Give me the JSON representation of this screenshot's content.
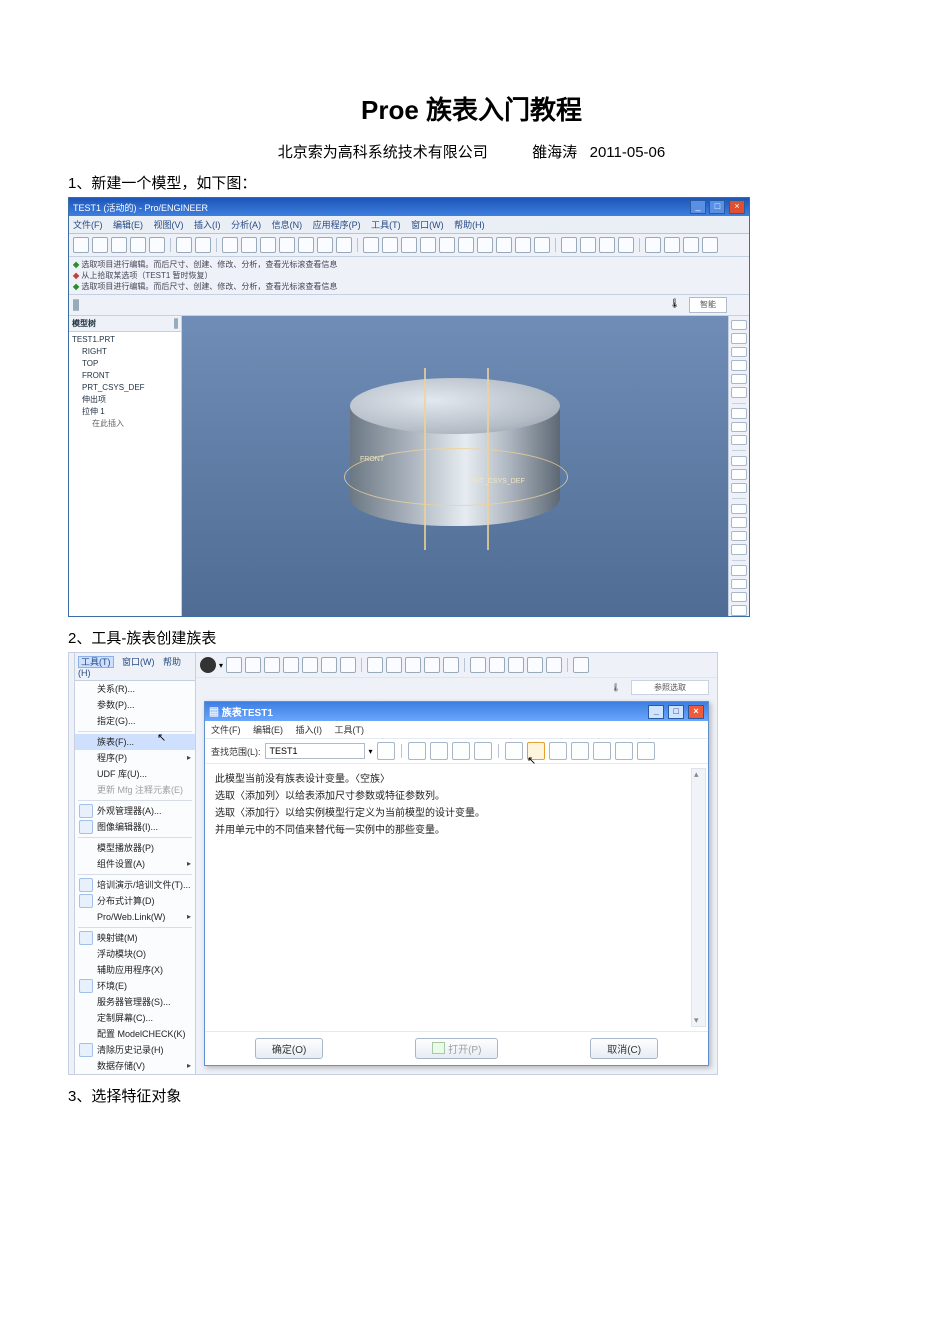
{
  "doc": {
    "title": "Proe 族表入门教程",
    "company": "北京索为高科系统技术有限公司",
    "author": "雒海涛",
    "date": "2011-05-06",
    "step1": "1、新建一个模型，如下图：",
    "step2": "2、工具-族表创建族表",
    "step3": "3、选择特征对象"
  },
  "shot1": {
    "title": "TEST1 (活动的) - Pro/ENGINEER",
    "menus": [
      "文件(F)",
      "编辑(E)",
      "视图(V)",
      "插入(I)",
      "分析(A)",
      "信息(N)",
      "应用程序(P)",
      "工具(T)",
      "窗口(W)",
      "帮助(H)"
    ],
    "msg1": "选取项目进行编辑。而后尺寸、创建、修改、分析，查看光标滚查看信息",
    "msg2": "从上拾取某选项（TEST1 暂时恢复）",
    "msg3": "选取项目进行编辑。而后尺寸、创建、修改、分析，查看光标滚查看信息",
    "filter": "智能",
    "tree": {
      "header": "模型树",
      "items": [
        {
          "t": "TEST1.PRT",
          "cls": ""
        },
        {
          "t": "RIGHT",
          "cls": "ind1"
        },
        {
          "t": "TOP",
          "cls": "ind1"
        },
        {
          "t": "FRONT",
          "cls": "ind1"
        },
        {
          "t": "PRT_CSYS_DEF",
          "cls": "ind1"
        },
        {
          "t": "伸出项",
          "cls": "ind1"
        },
        {
          "t": "拉伸 1",
          "cls": "ind1"
        },
        {
          "t": "在此插入",
          "cls": "ind2"
        }
      ]
    },
    "labels": {
      "front": "FRONT",
      "csys": "PRT_CSYS_DEF"
    }
  },
  "shot2": {
    "topmenu": [
      "工具(T)",
      "窗口(W)",
      "帮助(H)"
    ],
    "items": [
      {
        "t": "关系(R)...",
        "ico": false
      },
      {
        "t": "参数(P)...",
        "ico": false
      },
      {
        "t": "指定(G)...",
        "ico": false
      },
      {
        "div": true
      },
      {
        "t": "族表(F)...",
        "ico": false,
        "hover": true
      },
      {
        "t": "程序(P)",
        "arr": true,
        "ico": false
      },
      {
        "t": "UDF 库(U)...",
        "ico": false
      },
      {
        "t": "更新 Mfg 注释元素(E)",
        "ico": false,
        "dis": true
      },
      {
        "div": true
      },
      {
        "t": "外观管理器(A)...",
        "ico": true
      },
      {
        "t": "图像编辑器(I)...",
        "ico": true
      },
      {
        "div": true
      },
      {
        "t": "模型播放器(P)",
        "ico": false
      },
      {
        "t": "组件设置(A)",
        "arr": true,
        "ico": false
      },
      {
        "div": true
      },
      {
        "t": "培训演示/培训文件(T)...",
        "ico": true
      },
      {
        "t": "分布式计算(D)",
        "ico": true
      },
      {
        "t": "Pro/Web.Link(W)",
        "arr": true,
        "ico": false
      },
      {
        "div": true
      },
      {
        "t": "映射键(M)",
        "ico": true
      },
      {
        "t": "浮动模块(O)",
        "ico": false
      },
      {
        "t": "辅助应用程序(X)",
        "ico": false
      },
      {
        "t": "环境(E)",
        "ico": true
      },
      {
        "t": "服务器管理器(S)...",
        "ico": false
      },
      {
        "t": "定制屏幕(C)...",
        "ico": false
      },
      {
        "t": "配置 ModelCHECK(K)",
        "ico": false
      },
      {
        "t": "清除历史记录(H)",
        "ico": true
      },
      {
        "t": "数据存储(V)",
        "arr": true,
        "ico": false
      }
    ],
    "therm": "参照选取",
    "dialog": {
      "title": "族表TEST1",
      "menus": [
        "文件(F)",
        "编辑(E)",
        "插入(I)",
        "工具(T)"
      ],
      "lookLabel": "查找范围(L):",
      "lookValue": "TEST1",
      "lines": [
        "此模型当前没有族表设计变量。〈空族〉",
        "选取〈添加列〉以给表添加尺寸参数或特征参数列。",
        "选取〈添加行〉以给实例模型行定义为当前模型的设计变量。",
        "并用单元中的不同值来替代每一实例中的那些变量。"
      ],
      "ok": "确定(O)",
      "open": "打开(P)",
      "cancel": "取消(C)"
    }
  }
}
